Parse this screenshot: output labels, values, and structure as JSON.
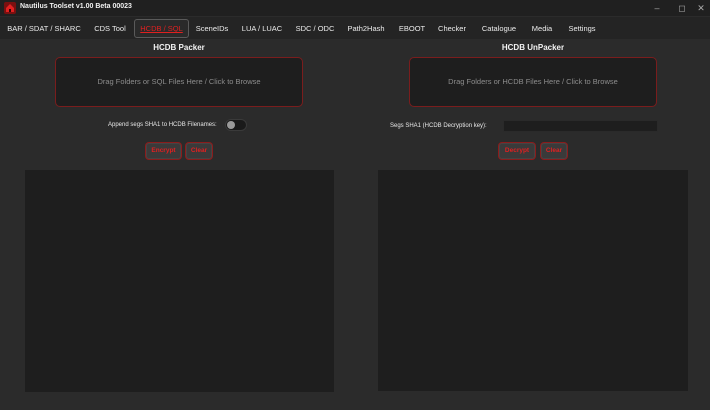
{
  "window": {
    "title": "Nautilus Toolset v1.00 Beta 00023",
    "controls": [
      "–",
      "◻",
      "✕"
    ]
  },
  "tabs": [
    {
      "label": "BAR / SDAT / SHARC"
    },
    {
      "label": "CDS Tool"
    },
    {
      "label": "HCDB / SQL",
      "active": true
    },
    {
      "label": "SceneIDs"
    },
    {
      "label": "LUA / LUAC"
    },
    {
      "label": "SDC / ODC"
    },
    {
      "label": "Path2Hash"
    },
    {
      "label": "EBOOT"
    },
    {
      "label": "Checker"
    },
    {
      "label": "Catalogue"
    },
    {
      "label": "Media"
    },
    {
      "label": "Settings"
    }
  ],
  "packer": {
    "title": "HCDB Packer",
    "dropzone_text": "Drag Folders or SQL Files Here / Click to Browse",
    "toggle_label": "Append segs SHA1 to HCDB Filenames:",
    "toggle_on": false,
    "encrypt_label": "Encrypt",
    "clear_label": "Clear"
  },
  "unpacker": {
    "title": "HCDB UnPacker",
    "dropzone_text": "Drag Folders or HCDB Files Here / Click to Browse",
    "key_label": "Segs SHA1 (HCDB Decryption key):",
    "key_value": "",
    "decrypt_label": "Decrypt",
    "clear_label": "Clear"
  },
  "colors": {
    "accent": "#e02020",
    "background": "#2b2b2b",
    "panel": "#1e1e1e"
  }
}
